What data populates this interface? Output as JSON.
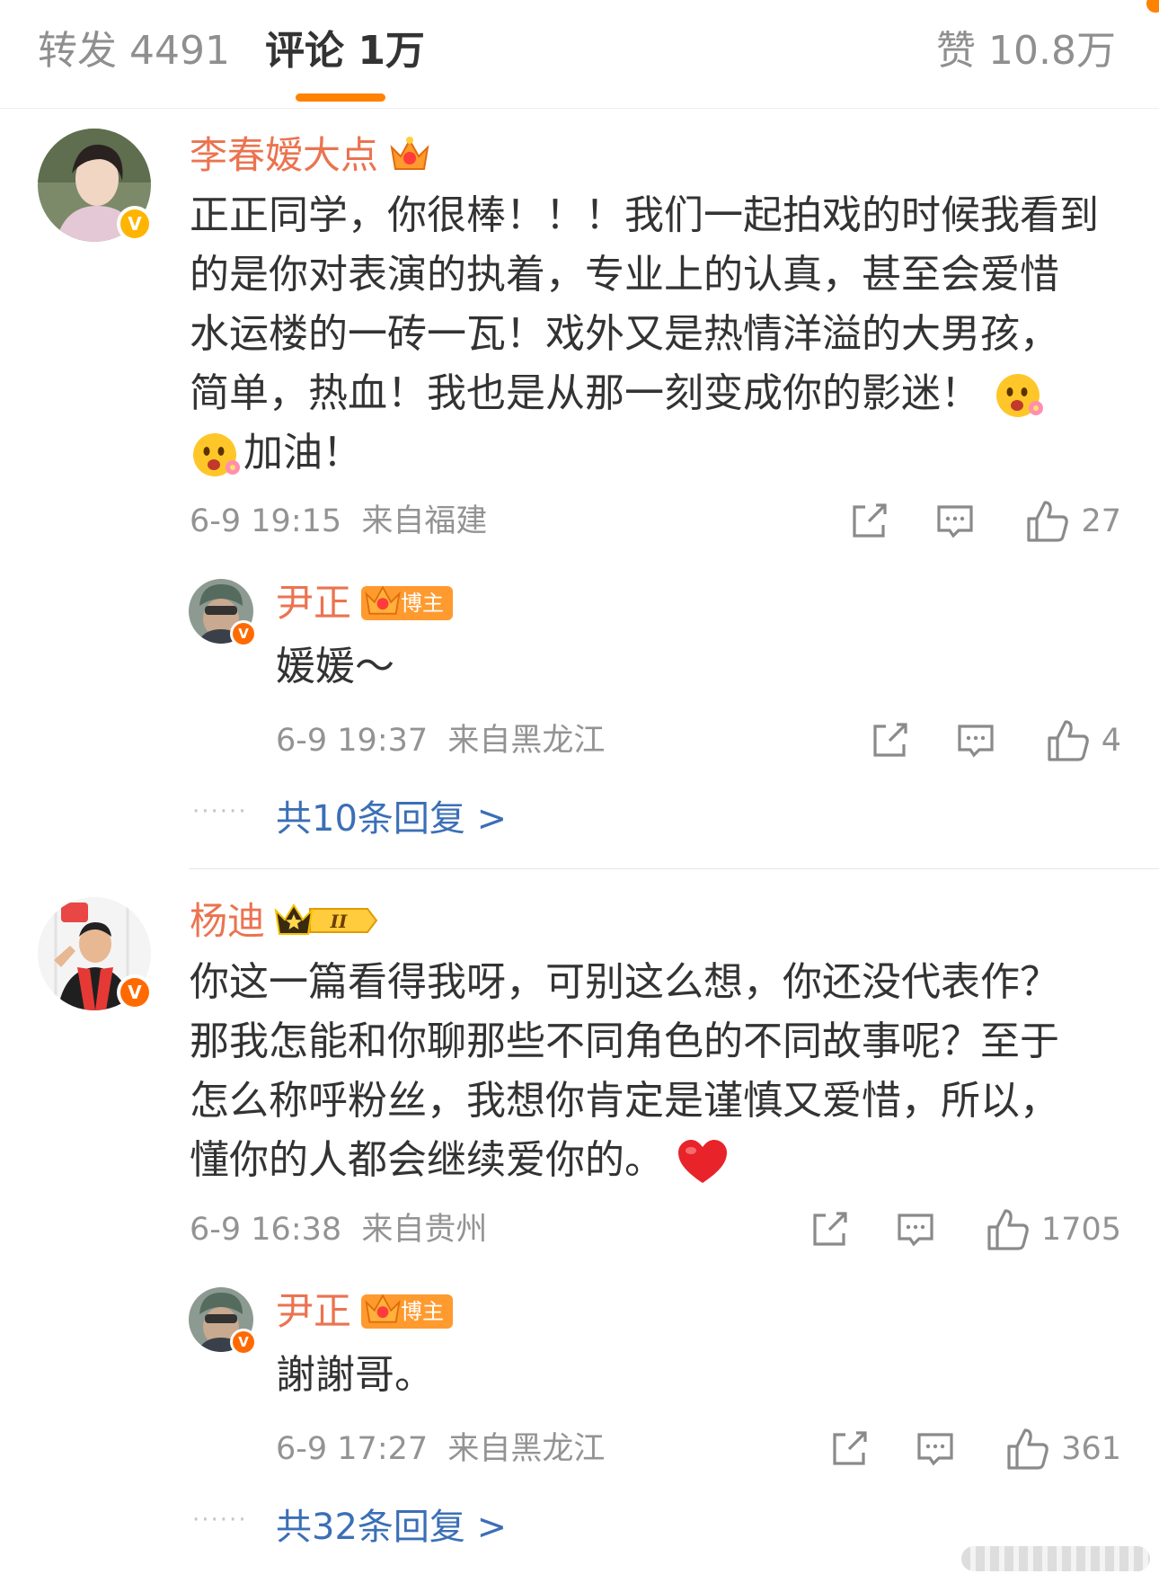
{
  "tabs": {
    "repost": "转发 4491",
    "comment": "评论 1万",
    "like": "赞 10.8万"
  },
  "colors": {
    "accent": "#ff8200",
    "username": "#eb7350",
    "link": "#3b6fb6",
    "meta": "#939393"
  },
  "comments": [
    {
      "user": "李春嫒大点",
      "text_lines": [
        "正正同学，你很棒！！！我们一起拍戏的时候我看到",
        "的是你对表演的执着，专业上的认真，甚至会爱惜",
        "水运楼的一砖一瓦！戏外又是热情洋溢的大男孩，",
        "简单，热血！我也是从那一刻变成你的影迷！"
      ],
      "text_last": "加油！",
      "time": "6-9 19:15",
      "location": "来自福建",
      "likes": "27",
      "reply": {
        "user": "尹正",
        "tag": "博主",
        "text": "媛媛～",
        "time": "6-9 19:37",
        "location": "来自黑龙江",
        "likes": "4"
      },
      "more_replies": "共10条回复 >"
    },
    {
      "user": "杨迪",
      "level": "II",
      "text_lines": [
        "你这一篇看得我呀，可别这么想，你还没代表作？",
        "那我怎能和你聊那些不同角色的不同故事呢？至于",
        "怎么称呼粉丝，我想你肯定是谨慎又爱惜，所以，"
      ],
      "text_last": "懂你的人都会继续爱你的。",
      "time": "6-9 16:38",
      "location": "来自贵州",
      "likes": "1705",
      "reply": {
        "user": "尹正",
        "tag": "博主",
        "text": "謝謝哥。",
        "time": "6-9 17:27",
        "location": "来自黑龙江",
        "likes": "361"
      },
      "more_replies": "共32条回复 >"
    }
  ]
}
